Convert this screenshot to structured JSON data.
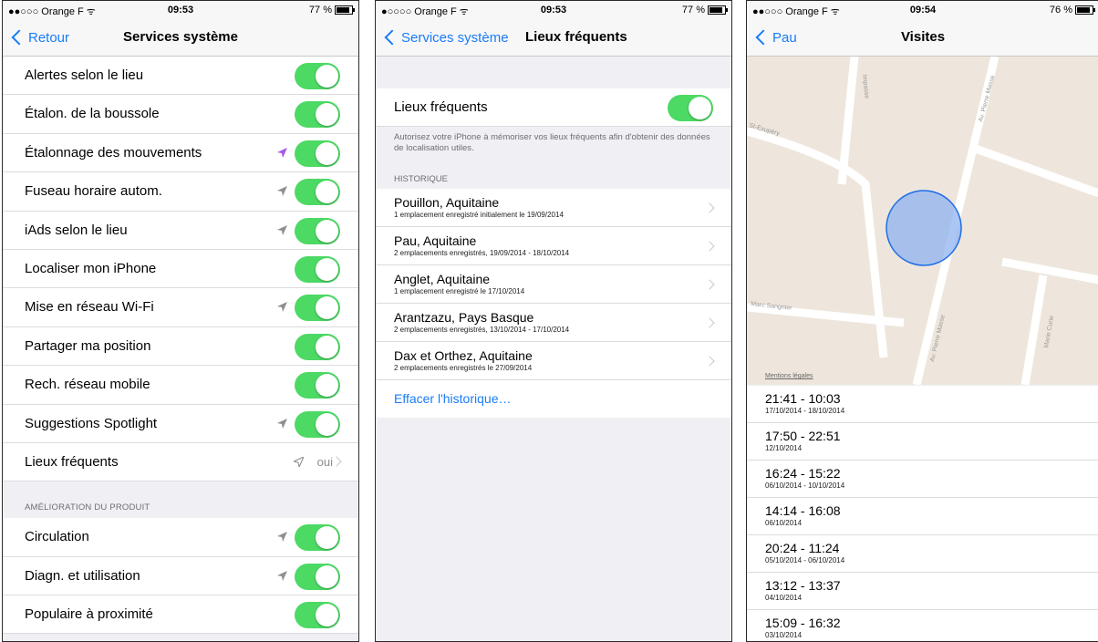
{
  "status": [
    {
      "carrier": "●●○○○ Orange F ᯤ",
      "time": "09:53",
      "battery": "77 %"
    },
    {
      "carrier": "●○○○○ Orange F ᯤ",
      "time": "09:53",
      "battery": "77 %"
    },
    {
      "carrier": "●●○○○ Orange F ᯤ",
      "time": "09:54",
      "battery": "76 %"
    }
  ],
  "panel1": {
    "back": "Retour",
    "title": "Services système",
    "rows": [
      {
        "label": "Alertes selon le lieu"
      },
      {
        "label": "Étalon. de la boussole"
      },
      {
        "label": "Étalonnage des mouvements"
      },
      {
        "label": "Fuseau horaire autom."
      },
      {
        "label": "iAds selon le lieu"
      },
      {
        "label": "Localiser mon iPhone"
      },
      {
        "label": "Mise en réseau Wi-Fi"
      },
      {
        "label": "Partager ma position"
      },
      {
        "label": "Rech. réseau mobile"
      },
      {
        "label": "Suggestions Spotlight"
      },
      {
        "label": "Lieux fréquents",
        "value": "oui"
      }
    ],
    "section": "AMÉLIORATION DU PRODUIT",
    "rows2": [
      {
        "label": "Circulation"
      },
      {
        "label": "Diagn. et utilisation"
      },
      {
        "label": "Populaire à proximité"
      }
    ],
    "colors": {
      "toggle": "#4cd964",
      "accent": "#1a7cf5",
      "loc_purple": "#a557e8",
      "loc_gray": "#8e8e93"
    }
  },
  "panel2": {
    "back": "Services système",
    "title": "Lieux fréquents",
    "toggle_label": "Lieux fréquents",
    "note": "Autorisez votre iPhone à mémoriser vos lieux fréquents afin d'obtenir des données de localisation utiles.",
    "history_head": "HISTORIQUE",
    "history": [
      {
        "place": "Pouillon, Aquitaine",
        "detail": "1 emplacement enregistré initialement le 19/09/2014"
      },
      {
        "place": "Pau, Aquitaine",
        "detail": "2 emplacements enregistrés, 19/09/2014 - 18/10/2014"
      },
      {
        "place": "Anglet, Aquitaine",
        "detail": "1 emplacement enregistré le 17/10/2014"
      },
      {
        "place": "Arantzazu, Pays Basque",
        "detail": "2 emplacements enregistrés, 13/10/2014 - 17/10/2014"
      },
      {
        "place": "Dax et Orthez, Aquitaine",
        "detail": "2 emplacements enregistrés le 27/09/2014"
      }
    ],
    "clear": "Effacer l'historique…"
  },
  "panel3": {
    "back": "Pau",
    "title": "Visites",
    "map_credit": "Mentions légales",
    "streets": [
      "Impasse",
      "Av. Pierre Masse",
      "St-Exupéry",
      "Marc Sangnier",
      "Av. Pierre Masse",
      "Marie Curie"
    ],
    "visits": [
      {
        "time": "21:41 - 10:03",
        "date": "17/10/2014 - 18/10/2014"
      },
      {
        "time": "17:50 - 22:51",
        "date": "12/10/2014"
      },
      {
        "time": "16:24 - 15:22",
        "date": "06/10/2014 - 10/10/2014"
      },
      {
        "time": "14:14 - 16:08",
        "date": "06/10/2014"
      },
      {
        "time": "20:24 - 11:24",
        "date": "05/10/2014 - 06/10/2014"
      },
      {
        "time": "13:12 - 13:37",
        "date": "04/10/2014"
      },
      {
        "time": "15:09 - 16:32",
        "date": "03/10/2014"
      }
    ]
  }
}
